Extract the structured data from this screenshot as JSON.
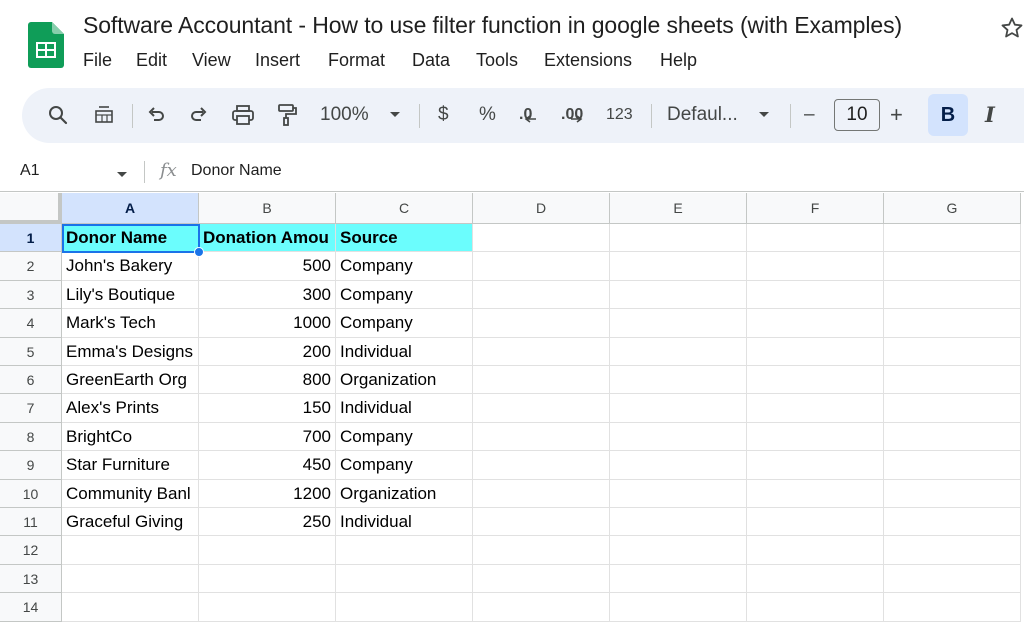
{
  "app": {
    "doc_title": "Software Accountant - How to use filter function in google sheets (with Examples)",
    "menu": [
      "File",
      "Edit",
      "View",
      "Insert",
      "Format",
      "Data",
      "Tools",
      "Extensions",
      "Help"
    ]
  },
  "toolbar": {
    "zoom": "100%",
    "currency": "$",
    "percent": "%",
    "decrease_decimal": ".0",
    "increase_decimal": ".00",
    "number_format": "123",
    "font": "Defaul...",
    "minus": "–",
    "font_size": "10",
    "plus": "+",
    "bold": "B",
    "italic": "I"
  },
  "formula_bar": {
    "cell_ref": "A1",
    "fx": "fx",
    "content": "Donor Name"
  },
  "sheet": {
    "columns": [
      "A",
      "B",
      "C",
      "D",
      "E",
      "F",
      "G"
    ],
    "rows": [
      "1",
      "2",
      "3",
      "4",
      "5",
      "6",
      "7",
      "8",
      "9",
      "10",
      "11",
      "12",
      "13",
      "14"
    ],
    "data": [
      [
        "Donor Name",
        "Donation Amou",
        "Source"
      ],
      [
        "John's Bakery",
        "500",
        "Company"
      ],
      [
        "Lily's Boutique",
        "300",
        "Company"
      ],
      [
        "Mark's Tech",
        "1000",
        "Company"
      ],
      [
        "Emma's Designs",
        "200",
        "Individual"
      ],
      [
        "GreenEarth Org",
        "800",
        "Organization"
      ],
      [
        "Alex's Prints",
        "150",
        "Individual"
      ],
      [
        "BrightCo",
        "700",
        "Company"
      ],
      [
        "Star Furniture",
        "450",
        "Company"
      ],
      [
        "Community Banl",
        "1200",
        "Organization"
      ],
      [
        "Graceful Giving",
        "250",
        "Individual"
      ]
    ],
    "selected_cell": "A1",
    "header_fill": "#6bfdfd"
  },
  "colors": {
    "accent": "#1a73e8",
    "selection_header": "#d3e3fd",
    "toolbar_bg": "#eef2f9"
  }
}
